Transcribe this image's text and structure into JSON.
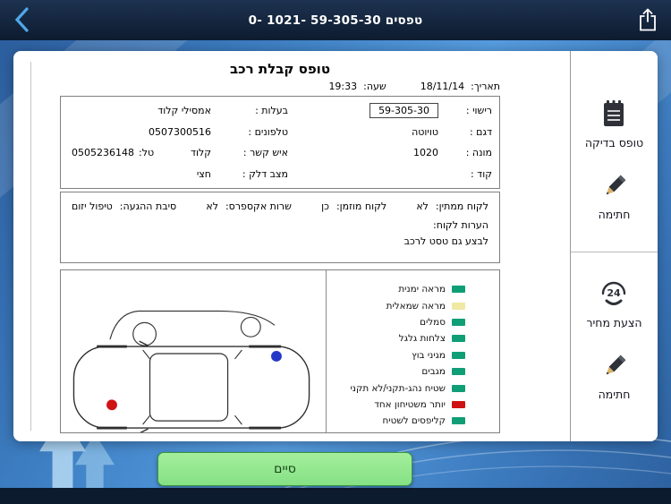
{
  "colors": {
    "status_green": "#0f9e76",
    "status_yellow": "#efe9a4",
    "status_red": "#d01111",
    "accent_blue": "#3d7ec2",
    "navbar_bg": "#12233c",
    "button_green": "#93e88d"
  },
  "navbar": {
    "title": "0- 1021- 59-305-30 טפסים",
    "back_icon": "chevron-left",
    "share_icon": "share-arrow-up"
  },
  "form": {
    "title": "טופס קבלת רכב",
    "date_label": "תאריך:",
    "date_value": "18/11/14",
    "time_label": "שעה:",
    "time_value": "19:33",
    "vehicle": {
      "license_label": "רישוי :",
      "license_value": "59-305-30",
      "model_label": "דגם :",
      "model_value": "טויוטה",
      "odometer_label": "מונה :",
      "odometer_value": "1020",
      "code_label": "קוד :",
      "code_value": "",
      "owner_label": "בעלות :",
      "owner_value": "אמסילי קלוד",
      "phones_label": "טלפונים :",
      "phones_value": "0507300516",
      "contact_label": "איש קשר :",
      "contact_value": "קלוד",
      "tel_label": "טל:",
      "tel_value": "0505236148",
      "fuel_label": "מצב דלק :",
      "fuel_value": "חצי"
    },
    "visit": {
      "waiting_label": "לקוח ממתין:",
      "waiting_value": "לא",
      "scheduled_label": "לקוח מוזמן:",
      "scheduled_value": "כן",
      "express_label": "שרות אקספרס:",
      "express_value": "לא",
      "reason_label": "סיבת ההגעה:",
      "reason_value": "טיפול יזום",
      "notes_label": "הערות לקוח:",
      "notes_text": "לבצע גם טסט לרכב"
    },
    "checklist": [
      {
        "label": "מראה ימנית",
        "status": "green"
      },
      {
        "label": "מראה שמאלית",
        "status": "yellow"
      },
      {
        "label": "סמלים",
        "status": "green"
      },
      {
        "label": "צלחות גלגל",
        "status": "green"
      },
      {
        "label": "מגיני בוץ",
        "status": "green"
      },
      {
        "label": "מגבים",
        "status": "green"
      },
      {
        "label": "שטיח נהג-תקני/לא תקני",
        "status": "green"
      },
      {
        "label": "יותר משטיחון אחד",
        "status": "red"
      },
      {
        "label": "קליפסים לשטיח",
        "status": "green"
      }
    ],
    "diagram_markers": [
      {
        "color": "red",
        "position": "rear-left"
      },
      {
        "color": "blue",
        "position": "front-right"
      }
    ]
  },
  "sidebar": {
    "inspection_label": "טופס בדיקה",
    "signature1_label": "חתימה",
    "quote_label": "הצעת מחיר",
    "quote_icon_text": "24",
    "signature2_label": "חתימה"
  },
  "footer": {
    "finish_label": "סיים"
  }
}
